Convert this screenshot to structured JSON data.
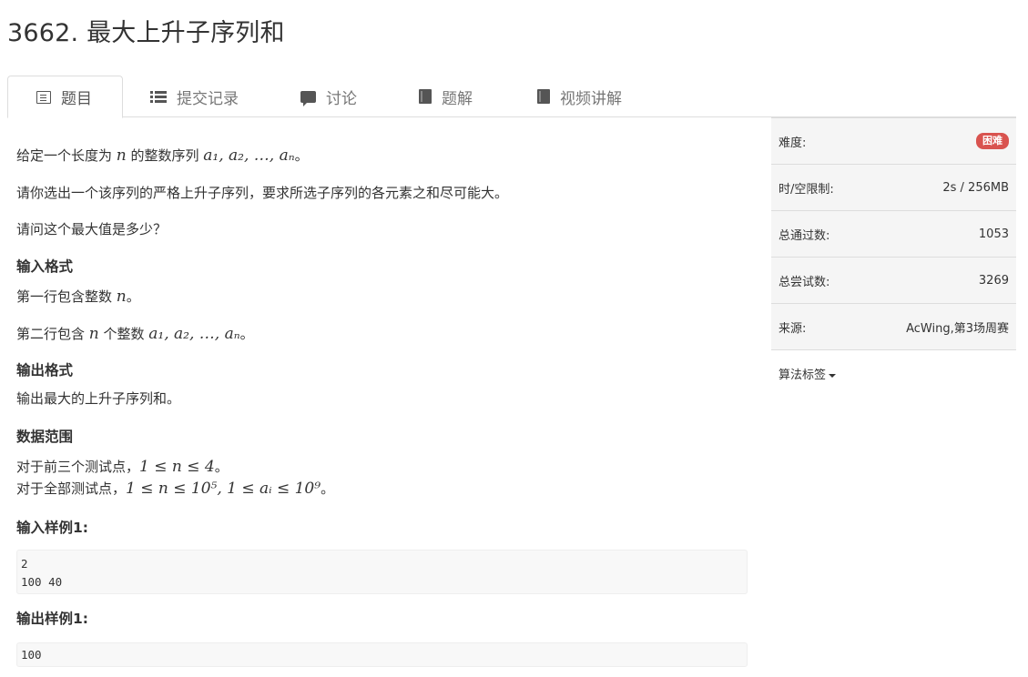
{
  "page": {
    "title": "3662. 最大上升子序列和"
  },
  "tabs": [
    {
      "label": "题目",
      "icon": "list-alt-icon",
      "active": true
    },
    {
      "label": "提交记录",
      "icon": "th-list-icon",
      "active": false
    },
    {
      "label": "讨论",
      "icon": "comment-icon",
      "active": false
    },
    {
      "label": "题解",
      "icon": "book-icon",
      "active": false
    },
    {
      "label": "视频讲解",
      "icon": "book-icon",
      "active": false
    }
  ],
  "problem": {
    "intro_prefix": "给定一个长度为 ",
    "intro_n": "n",
    "intro_mid": " 的整数序列 ",
    "intro_seq": "a₁, a₂, …, aₙ",
    "intro_suffix": "。",
    "p2": "请你选出一个该序列的严格上升子序列，要求所选子序列的各元素之和尽可能大。",
    "p3": "请问这个最大值是多少？",
    "input_heading": "输入格式",
    "input_line1_prefix": "第一行包含整数 ",
    "input_line1_var": "n",
    "input_line1_suffix": "。",
    "input_line2_prefix": "第二行包含 ",
    "input_line2_var": "n",
    "input_line2_mid": " 个整数 ",
    "input_line2_seq": "a₁, a₂, …, aₙ",
    "input_line2_suffix": "。",
    "output_heading": "输出格式",
    "output_line": "输出最大的上升子序列和。",
    "range_heading": "数据范围",
    "range_line1_prefix": "对于前三个测试点，",
    "range_line1_math": "1 ≤ n ≤ 4",
    "range_line1_suffix": "。",
    "range_line2_prefix": "对于全部测试点，",
    "range_line2_math": "1 ≤ n ≤ 10⁵, 1 ≤ aᵢ ≤ 10⁹",
    "range_line2_suffix": "。",
    "sample_input_heading": "输入样例1:",
    "sample_input_l1": "2",
    "sample_input_l2": "100 40",
    "sample_output_heading": "输出样例1:",
    "sample_output": "100"
  },
  "sidebar": {
    "difficulty_label": "难度:",
    "difficulty_value": "困难",
    "difficulty_color": "#d9534f",
    "limits_label": "时/空限制:",
    "limits_value": "2s / 256MB",
    "passed_label": "总通过数:",
    "passed_value": "1053",
    "attempts_label": "总尝试数:",
    "attempts_value": "3269",
    "source_label": "来源:",
    "source_value": "AcWing,第3场周赛",
    "tags_label": "算法标签"
  }
}
